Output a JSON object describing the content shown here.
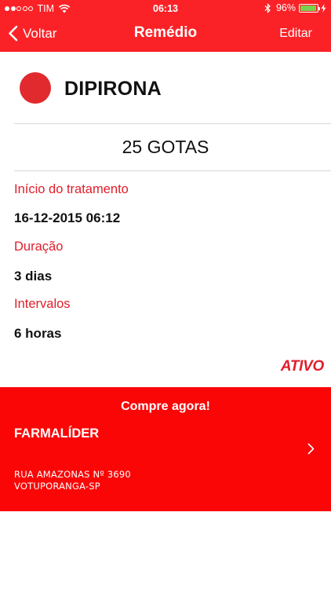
{
  "status_bar": {
    "carrier": "TIM",
    "time": "06:13",
    "battery_percent": "96%",
    "battery_level": 0.96,
    "signal_bars_filled": 2,
    "signal_bars_total": 5
  },
  "nav": {
    "back_label": "Voltar",
    "title": "Remédio",
    "edit_label": "Editar"
  },
  "medicine": {
    "name": "DIPIRONA",
    "color": "#e02a2e",
    "dose": "25 GOTAS"
  },
  "details": {
    "start_label": "Início do tratamento",
    "start_value": "16-12-2015 06:12",
    "duration_label": "Duração",
    "duration_value": "3 dias",
    "interval_label": "Intervalos",
    "interval_value": "6 horas"
  },
  "status": "ATIVO",
  "promo": {
    "title": "Compre agora!",
    "store_name": "FARMALÍDER",
    "address_line1": "RUA AMAZONAS Nº 3690",
    "address_line2": "VOTUPORANGA-SP"
  },
  "colors": {
    "brand_red": "#fb2227",
    "promo_red": "#fb0606",
    "label_red": "#e01e2a",
    "battery_green": "#7ad14f"
  },
  "icons": {
    "back": "chevron-left-icon",
    "promo_arrow": "chevron-right-icon",
    "wifi": "wifi-icon",
    "bluetooth": "bluetooth-icon",
    "battery": "battery-icon",
    "charging": "bolt-icon"
  }
}
